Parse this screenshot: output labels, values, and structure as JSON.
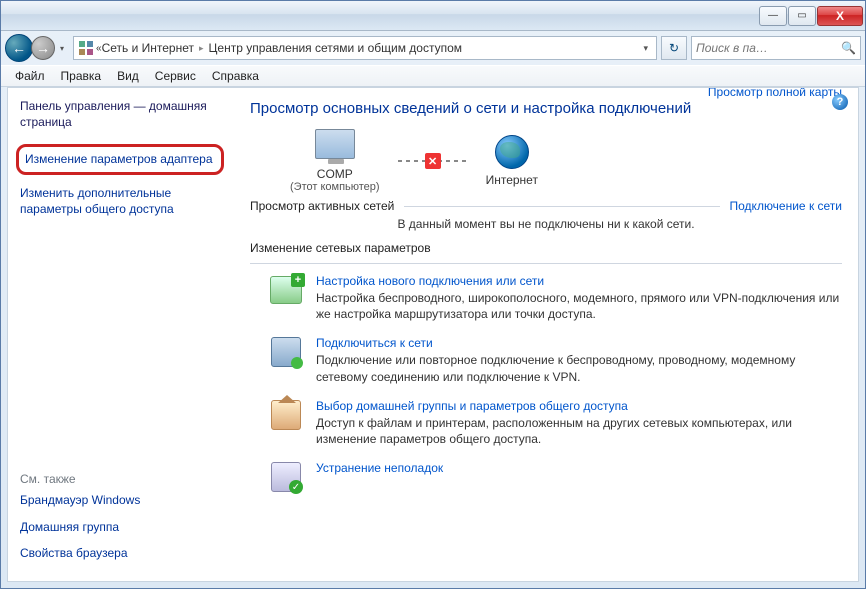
{
  "window_buttons": {
    "min": "—",
    "max": "▭",
    "close": "X"
  },
  "nav": {
    "back": "←",
    "fwd": "→",
    "drop": "▾"
  },
  "breadcrumb": {
    "chevrons": "«",
    "part1": "Сеть и Интернет",
    "part2": "Центр управления сетями и общим доступом",
    "sep": "▸",
    "drop": "▾"
  },
  "search": {
    "placeholder": "Поиск в па…",
    "icon": "🔍"
  },
  "refresh": "↻",
  "menu": {
    "file": "Файл",
    "edit": "Правка",
    "view": "Вид",
    "service": "Сервис",
    "help": "Справка"
  },
  "sidebar": {
    "home": "Панель управления — домашняя страница",
    "adapter": "Изменение параметров адаптера",
    "sharing": "Изменить дополнительные параметры общего доступа",
    "see_also": "См. также",
    "firewall": "Брандмауэр Windows",
    "homegroup": "Домашняя группа",
    "browser": "Свойства браузера"
  },
  "main": {
    "title": "Просмотр основных сведений о сети и настройка подключений",
    "fullmap": "Просмотр полной карты",
    "comp_name": "COMP",
    "comp_sub": "(Этот компьютер)",
    "internet": "Интернет",
    "active_label": "Просмотр активных сетей",
    "connect_link": "Подключение к сети",
    "nosig": "В данный момент вы не подключены ни к какой сети.",
    "change_label": "Изменение сетевых параметров",
    "tasks": [
      {
        "title": "Настройка нового подключения или сети",
        "desc": "Настройка беспроводного, широкополосного, модемного, прямого или VPN-подключения или же настройка маршрутизатора или точки доступа."
      },
      {
        "title": "Подключиться к сети",
        "desc": "Подключение или повторное подключение к беспроводному, проводному, модемному сетевому соединению или подключение к VPN."
      },
      {
        "title": "Выбор домашней группы и параметров общего доступа",
        "desc": "Доступ к файлам и принтерам, расположенным на других сетевых компьютерах, или изменение параметров общего доступа."
      },
      {
        "title": "Устранение неполадок",
        "desc": ""
      }
    ]
  },
  "help": "?"
}
